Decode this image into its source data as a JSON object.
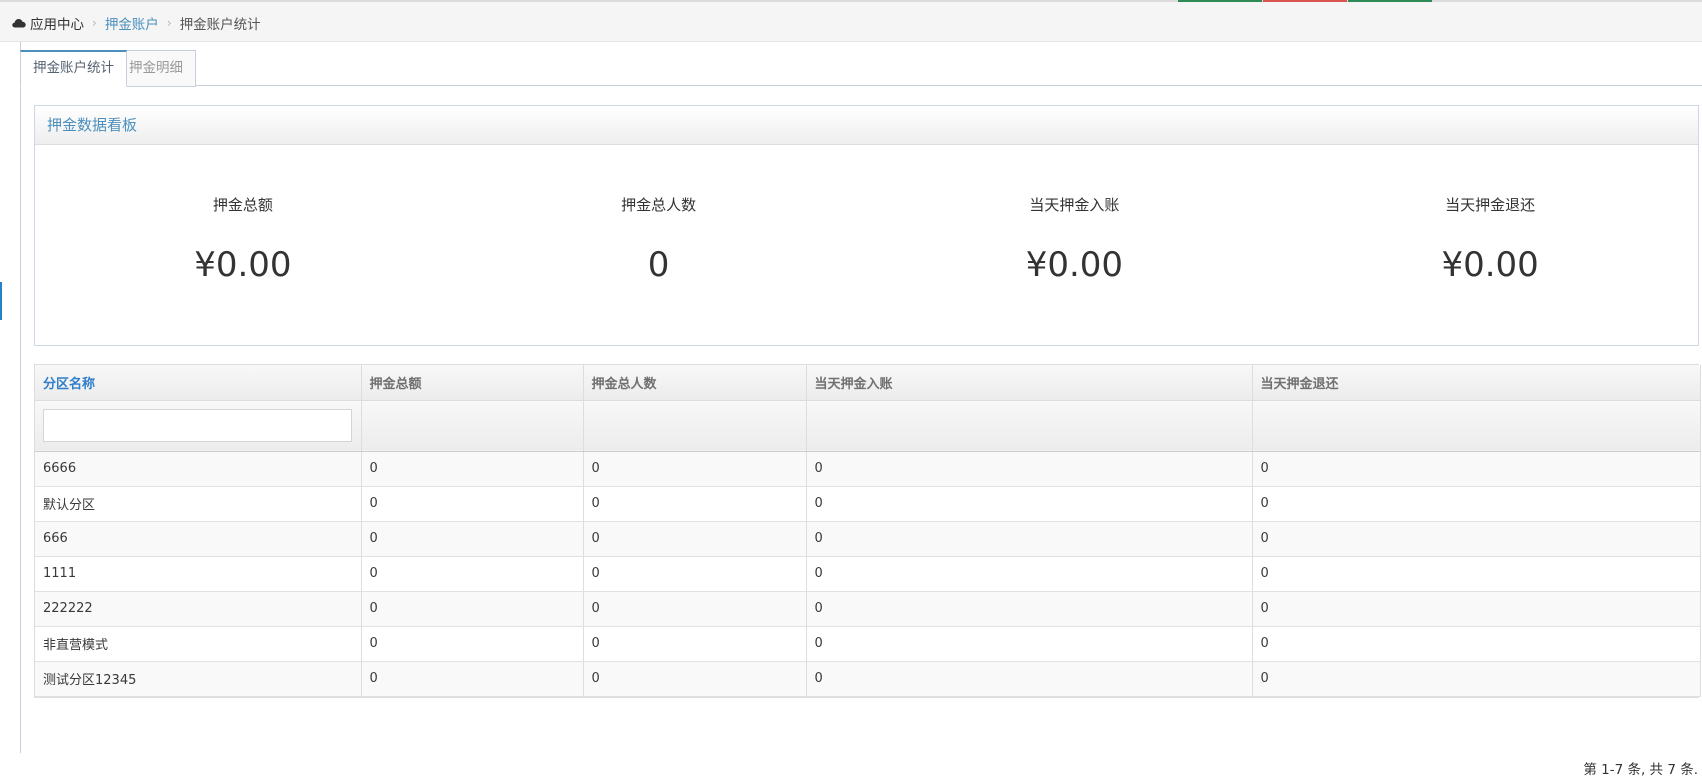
{
  "topbar": {
    "accents": [
      "#dcdcdc",
      "#2e8b57",
      "#d9534f",
      "#2e8b57"
    ]
  },
  "breadcrumb": {
    "icon": "cloud-icon",
    "home": "应用中心",
    "section": "押金账户",
    "current": "押金账户统计"
  },
  "tabs": [
    {
      "label": "押金账户统计",
      "active": true
    },
    {
      "label": "押金明细",
      "active": false
    }
  ],
  "dashboard": {
    "title": "押金数据看板",
    "stats": [
      {
        "label": "押金总额",
        "value": "¥0.00"
      },
      {
        "label": "押金总人数",
        "value": "0"
      },
      {
        "label": "当天押金入账",
        "value": "¥0.00"
      },
      {
        "label": "当天押金退还",
        "value": "¥0.00"
      }
    ]
  },
  "table": {
    "columns": [
      "分区名称",
      "押金总额",
      "押金总人数",
      "当天押金入账",
      "当天押金退还"
    ],
    "filter": {
      "value": "",
      "placeholder": ""
    },
    "rows": [
      [
        "6666",
        "0",
        "0",
        "0",
        "0"
      ],
      [
        "默认分区",
        "0",
        "0",
        "0",
        "0"
      ],
      [
        "666",
        "0",
        "0",
        "0",
        "0"
      ],
      [
        "1111",
        "0",
        "0",
        "0",
        "0"
      ],
      [
        "222222",
        "0",
        "0",
        "0",
        "0"
      ],
      [
        "非直营模式",
        "0",
        "0",
        "0",
        "0"
      ],
      [
        "测试分区12345",
        "0",
        "0",
        "0",
        "0"
      ]
    ]
  },
  "pager": {
    "info": "第 1-7 条, 共 7 条."
  },
  "colors": {
    "accent": "#4c8fbd",
    "sort_header": "#307ecc",
    "border": "#dddddd"
  }
}
